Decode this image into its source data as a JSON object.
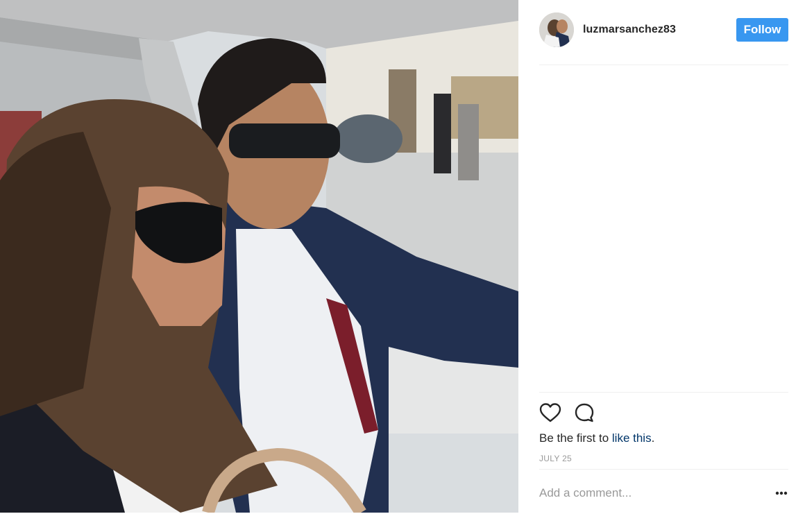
{
  "post": {
    "username": "luzmarsanchez83",
    "follow_label": "Follow",
    "likes_prefix": "Be the first to ",
    "likes_link": "like this",
    "likes_suffix": ".",
    "date": "JULY 25",
    "comment_placeholder": "Add a comment...",
    "more_label": "..."
  },
  "icons": {
    "like": "heart-icon",
    "comment": "comment-bubble-icon",
    "more": "more-options-icon"
  },
  "colors": {
    "follow_button": "#3897f0",
    "link": "#003569",
    "username": "#262626",
    "muted": "#999999",
    "divider": "#efefef"
  }
}
